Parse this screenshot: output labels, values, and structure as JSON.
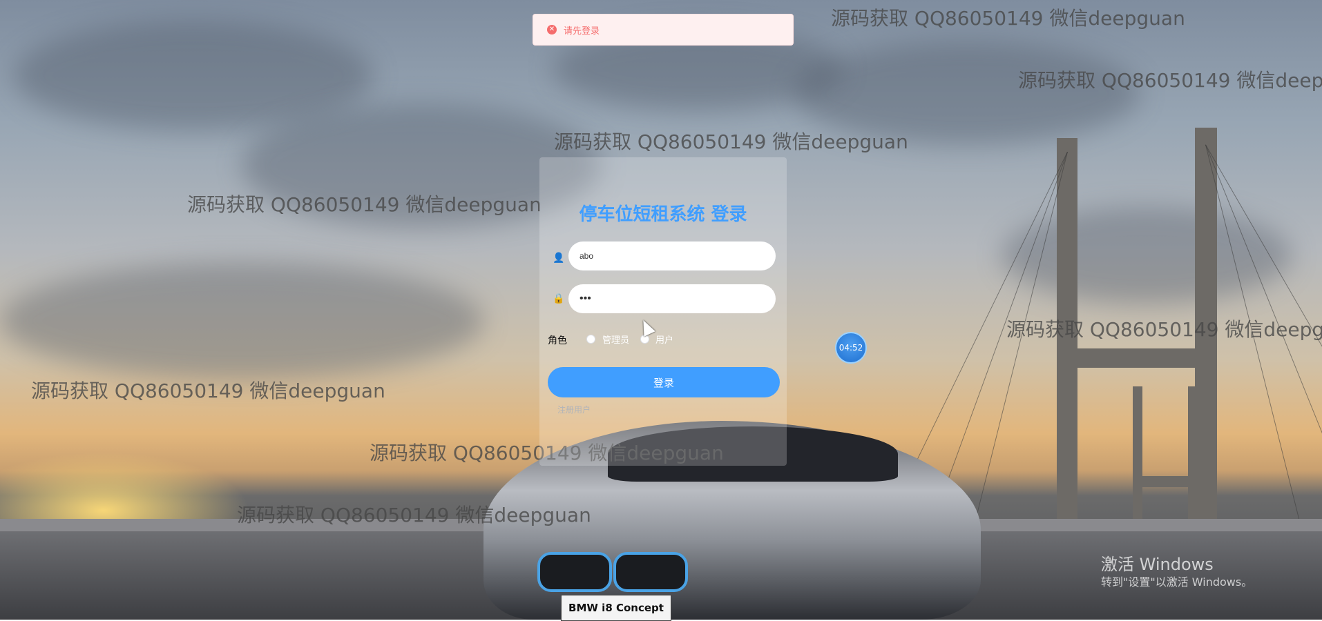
{
  "alert": {
    "icon": "error-circle-icon",
    "message": "请先登录",
    "color": "#f56c6c"
  },
  "watermark_text": "源码获取 QQ86050149 微信deepguan",
  "login": {
    "title": "停车位短租系统 登录",
    "username": {
      "icon": "user-icon",
      "value": "abo"
    },
    "password": {
      "icon": "lock-icon",
      "value": "•••"
    },
    "role": {
      "label": "角色",
      "options": [
        "管理员",
        "用户"
      ]
    },
    "submit_label": "登录",
    "register_label": "注册用户",
    "accent": "#409eff"
  },
  "timer": {
    "value": "04:52"
  },
  "car": {
    "plate": "BMW i8 Concept"
  },
  "windows_activation": {
    "title": "激活 Windows",
    "subtitle": "转到\"设置\"以激活 Windows。"
  }
}
